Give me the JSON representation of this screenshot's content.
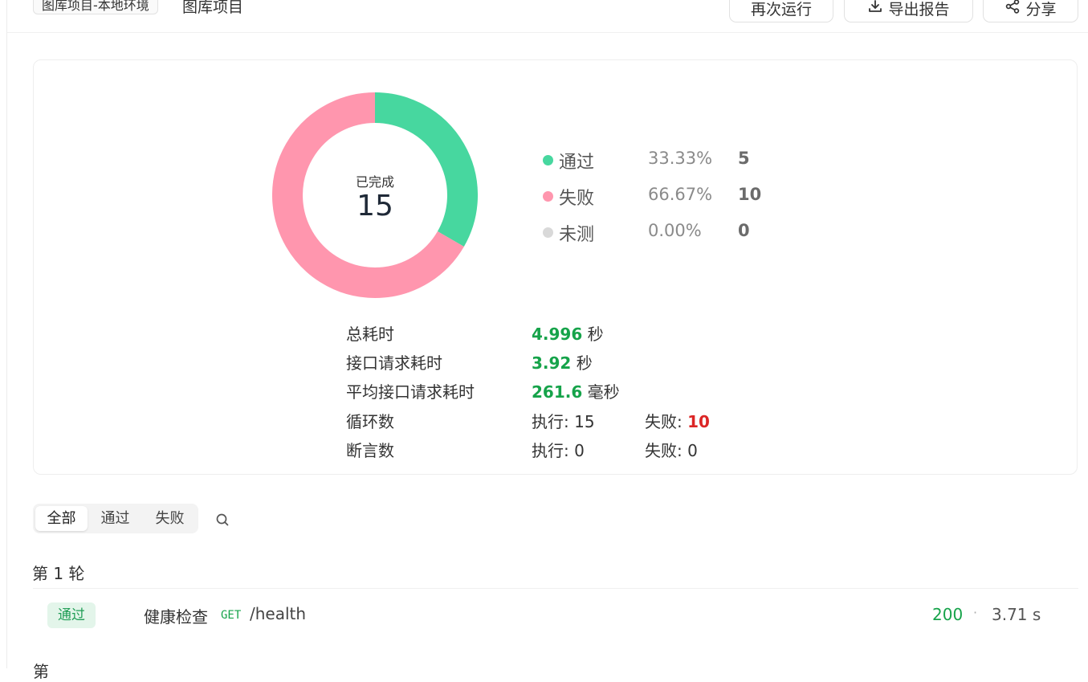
{
  "header": {
    "env_tag": "图库项目-本地环境",
    "project_name": "图库项目",
    "rerun_label": "再次运行",
    "export_label": "导出报告",
    "share_label": "分享"
  },
  "summary": {
    "completed_label": "已完成",
    "completed_value": "15",
    "legend": [
      {
        "name": "通过",
        "percent": "33.33%",
        "count": "5",
        "color": "#47d79f",
        "value": 5
      },
      {
        "name": "失败",
        "percent": "66.67%",
        "count": "10",
        "color": "#ff96ae",
        "value": 10
      },
      {
        "name": "未测",
        "percent": "0.00%",
        "count": "0",
        "color": "#d9d9d9",
        "value": 0
      }
    ],
    "stats": {
      "total_time_label": "总耗时",
      "total_time_value": "4.996",
      "total_time_unit": "秒",
      "api_time_label": "接口请求耗时",
      "api_time_value": "3.92",
      "api_time_unit": "秒",
      "avg_time_label": "平均接口请求耗时",
      "avg_time_value": "261.6",
      "avg_time_unit": "毫秒",
      "loop_label": "循环数",
      "loop_exec": "执行: 15",
      "loop_fail_label": "失败: ",
      "loop_fail_value": "10",
      "assert_label": "断言数",
      "assert_exec": "执行: 0",
      "assert_fail": "失败: 0"
    }
  },
  "filter": {
    "tabs": [
      "全部",
      "通过",
      "失败"
    ],
    "active_tab": "全部"
  },
  "rounds": [
    {
      "title": "第 1 轮",
      "requests": [
        {
          "status_badge": "通过",
          "name": "健康检查",
          "method": "GET",
          "path": "/health",
          "code": "200",
          "separator": "·",
          "time": "3.71 s"
        }
      ]
    }
  ],
  "next_round_partial": "第"
}
